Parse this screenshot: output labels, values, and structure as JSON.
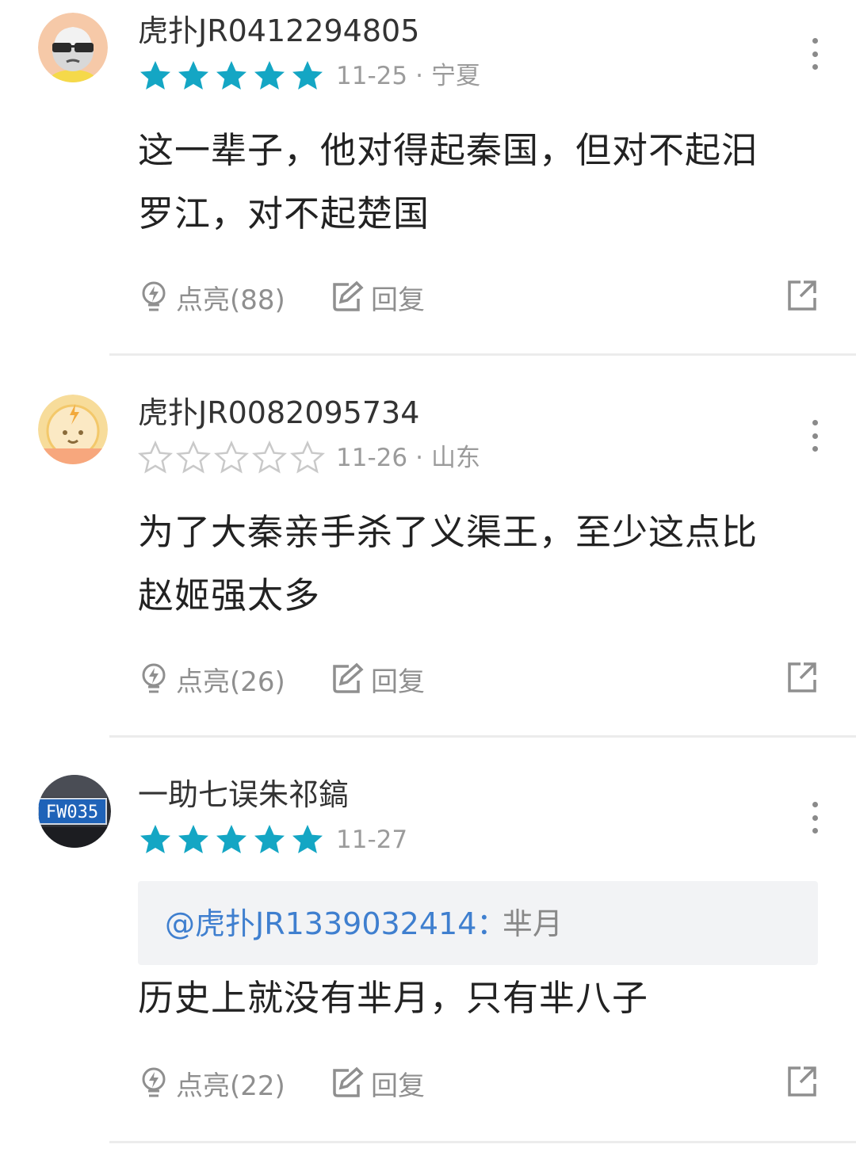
{
  "colors": {
    "star_filled": "#14a6c4",
    "star_empty": "#c9c9c9",
    "mention": "#3f7fcf",
    "muted": "#9b9b9b"
  },
  "comments": [
    {
      "username": "虎扑JR0412294805",
      "rating": 5,
      "date": "11-25",
      "location": "宁夏",
      "body_lines": [
        "这一辈子，他对得起秦国，但对不起汨",
        "罗江，对不起楚国"
      ],
      "like_label": "点亮(88)",
      "reply_label": "回复",
      "avatar_icon": "sunglasses-face-avatar"
    },
    {
      "username": "虎扑JR0082095734",
      "rating": 0,
      "date": "11-26",
      "location": "山东",
      "body_lines": [
        "为了大秦亲手杀了义渠王，至少这点比",
        "赵姬强太多"
      ],
      "like_label": "点亮(26)",
      "reply_label": "回复",
      "avatar_icon": "lightning-smiley-avatar"
    },
    {
      "username": "一助七误朱祁鎬",
      "rating": 5,
      "date": "11-27",
      "quote_user": "@虎扑JR1339032414：",
      "quote_text": "芈月",
      "body_lines": [
        "历史上就没有芈月，只有芈八子"
      ],
      "like_label": "点亮(22)",
      "reply_label": "回复",
      "avatar_plate": "FW035",
      "avatar_icon": "license-plate-avatar"
    }
  ]
}
